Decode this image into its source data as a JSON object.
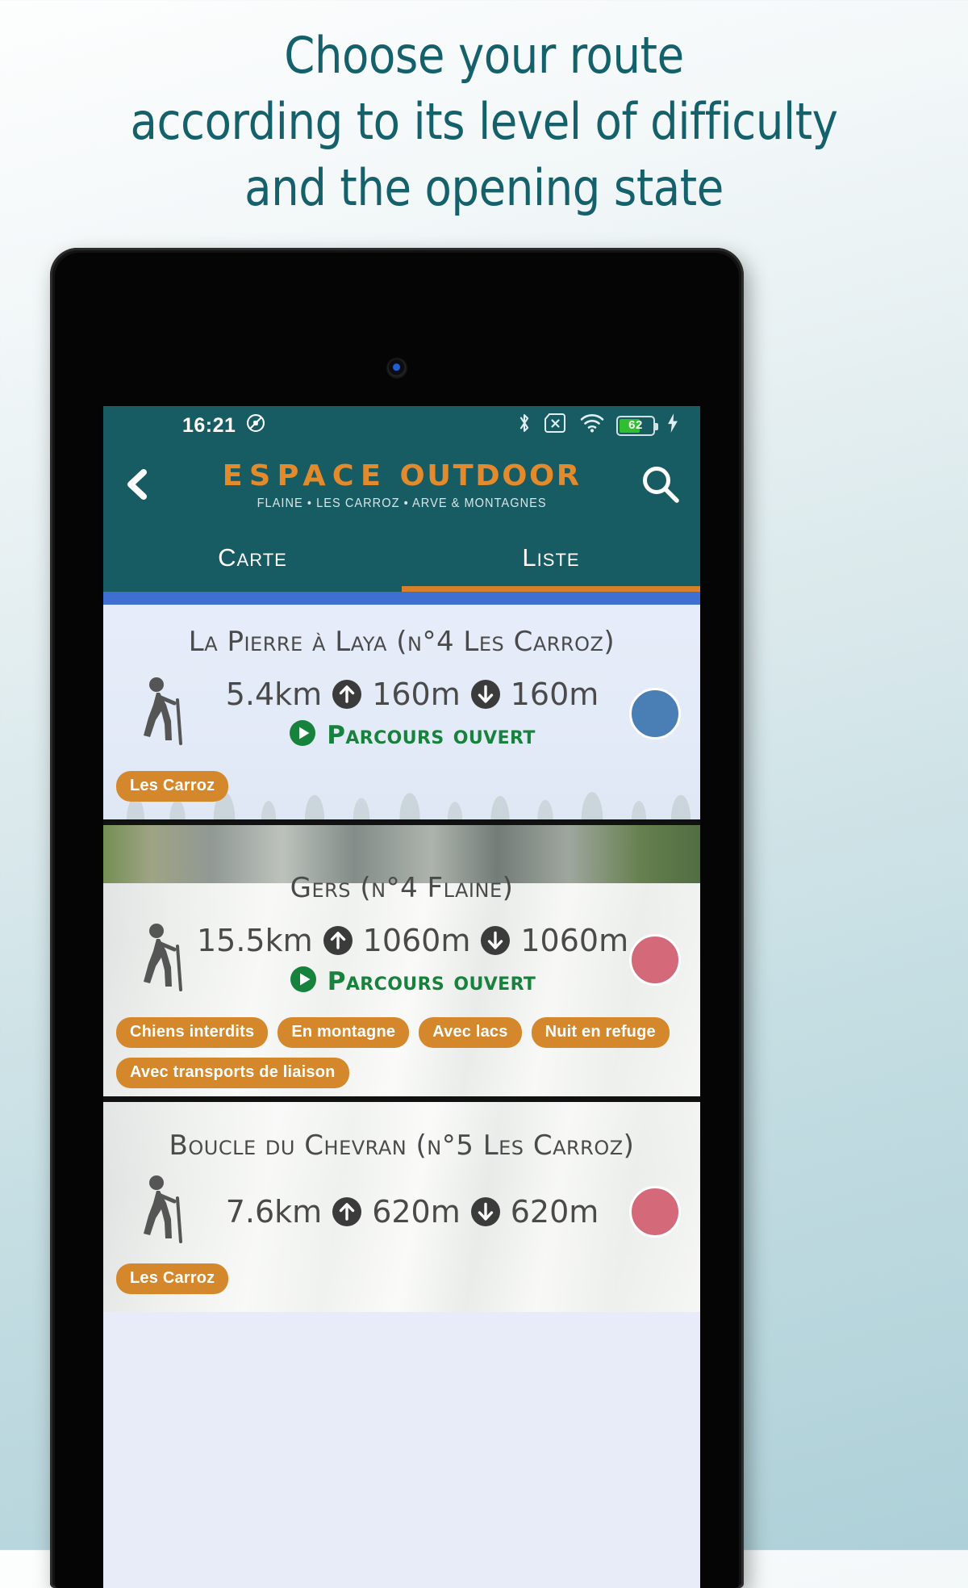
{
  "headline": {
    "line1": "Choose your route",
    "line2": "according to its level of difficulty",
    "line3": "and the opening state"
  },
  "colors": {
    "headline": "#14606b",
    "app_bar": "#175b63",
    "logo_orange": "#e38b2c",
    "tab_indicator": "#d5802b",
    "blue_bar": "#3f6fd0",
    "open_green": "#17823c",
    "tag_orange": "#d5872c",
    "difficulty_blue": "#4a7fb5",
    "difficulty_red": "#d4697a"
  },
  "status_bar": {
    "time": "16:21",
    "icons": [
      "rotation-lock-icon",
      "bluetooth-icon",
      "sim-card-off-icon",
      "wifi-icon",
      "battery-icon",
      "charging-bolt-icon"
    ],
    "battery_percent": "62"
  },
  "app_bar": {
    "back_icon": "back-chevron-icon",
    "search_icon": "search-icon",
    "logo_word1": "ESPACE",
    "logo_word2": "OUTDOOR",
    "logo_subtitle": "FLAINE • LES CARROZ • ARVE & MONTAGNES"
  },
  "tabs": [
    {
      "label": "Carte",
      "active": false
    },
    {
      "label": "Liste",
      "active": true
    }
  ],
  "routes": [
    {
      "title": "La Pierre à Laya (n°4 Les Carroz)",
      "distance": "5.4km",
      "ascent": "160m",
      "descent": "160m",
      "status": "Parcours ouvert",
      "status_icon": "play-circle-icon",
      "activity_icon": "hiker-icon",
      "difficulty_color": "#4a7fb5",
      "tags": [
        "Les Carroz"
      ]
    },
    {
      "title": "Gers (n°4 Flaine)",
      "distance": "15.5km",
      "ascent": "1060m",
      "descent": "1060m",
      "status": "Parcours ouvert",
      "status_icon": "play-circle-icon",
      "activity_icon": "hiker-icon",
      "difficulty_color": "#d4697a",
      "tags": [
        "Chiens interdits",
        "En montagne",
        "Avec lacs",
        "Nuit en refuge",
        "Avec transports de liaison"
      ]
    },
    {
      "title": "Boucle du Chevran (n°5 Les Carroz)",
      "distance": "7.6km",
      "ascent": "620m",
      "descent": "620m",
      "status": "",
      "status_icon": "",
      "activity_icon": "hiker-icon",
      "difficulty_color": "#d4697a",
      "tags": [
        "Les Carroz"
      ]
    }
  ]
}
